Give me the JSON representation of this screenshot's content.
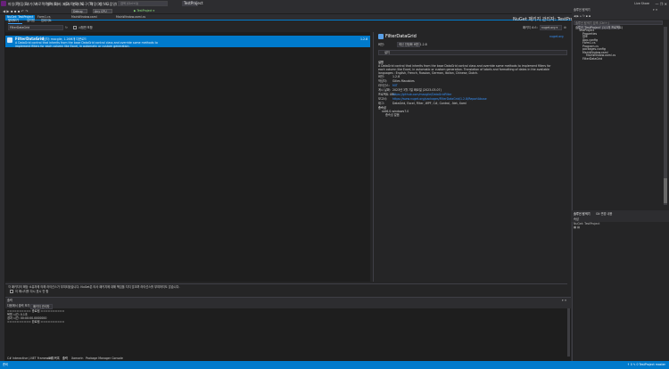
{
  "menu": [
    "파일(F)",
    "편집(E)",
    "보기(V)",
    "프로젝트(P)",
    "빌드(B)",
    "디버그(D)",
    "테스트(S)",
    "분석(N)",
    "도구(T)",
    "확장(X)",
    "창(W)",
    "도움말(H)"
  ],
  "search_placeholder": "검색 (Ctrl+Q)",
  "project_name": "TestProject",
  "window": {
    "user": "Live Share",
    "controls": "—  ❐  ✕"
  },
  "toolbar": {
    "config": "Debug",
    "platform": "Any CPU",
    "run": "▶ TestProject ▾"
  },
  "doc_tabs": [
    "NuGet: TestProject",
    "Form1.cs",
    "MainWindow.xaml",
    "MainWindow.xaml.cs"
  ],
  "nuget": {
    "title": "NuGet 패키지 관리자: TestProject",
    "tabs": [
      "찾아보기",
      "설치됨",
      "업데이트"
    ],
    "search_value": "FilterDataGrid",
    "prerelease": "시험판 포함",
    "source_label": "패키지 소스:",
    "source_value": "nuget.org ▾",
    "package": {
      "name": "FilterDataGrid",
      "author": "작성자: macgile, 1.26M개 다운로드",
      "desc1": "A DataGrid control that inherits from the base DataGrid control class and override some methods to",
      "desc2": "implement filters for each column like Excel, in automatic or custom generation.",
      "version": "1.2.8"
    },
    "detail": {
      "name": "FilterDataGrid",
      "nuget_link": "nuget.org",
      "version_label": "버전:",
      "version_value": "최신 안정화 버전 1.2.8",
      "install": "설치",
      "desc_label": "설명",
      "desc": "A DataGrid control that inherits from the base DataGrid control class and override some methods to implement filters for each column like Excel, in automatic or custom generation. Translation of labels and formatting of dates in the available languages : English, French, Russian, German, Italian, Chinese, Dutch.",
      "rows": [
        {
          "k": "버전:",
          "v": "1.2.8"
        },
        {
          "k": "작성자:",
          "v": "Gilles Macabies"
        },
        {
          "k": "라이선스:",
          "v": "MIT"
        },
        {
          "k": "게시 날짜:",
          "v": "2023년 3월 7일 화요일 (2023-03-07)"
        },
        {
          "k": "프로젝트 URL:",
          "v": "https://github.com/macgile/DataGridFilter"
        },
        {
          "k": "보고서:",
          "v": "https://www.nuget.org/packages/FilterDataGrid/1.2.8/ReportAbuse"
        },
        {
          "k": "태그:",
          "v": "DataGrid, Excel, Filter, WPF, C#, Control, .Net, Xaml"
        }
      ],
      "deps_label": "종속성",
      "deps": [
        "net6.0-windows7.0",
        "종속성 없음"
      ]
    },
    "note": "각 패키지의 해당 소유자에 의해 라이선스가 부여되었습니다. NuGet은 타사 패키지에 대해 책임을 지지 않으며 라이선스를 부여하지도 않습니다.",
    "dont_show": "이 메시지를 다시 표시 안 함"
  },
  "output": {
    "title": "출력",
    "show_from": "다음에서 출력 보기:",
    "source": "패키지 관리자",
    "lines": [
      "========== 종료됨 ==========",
      "복원 시간: 0.1초",
      "경과 시간: 00:00:00.0000000",
      "========== 완료됨 =========="
    ],
    "tabs": [
      "C# Interactive (.NET Framework)",
      "오류 목록",
      "출력",
      "Xamarin",
      "Package Manager Console"
    ]
  },
  "solution": {
    "title": "솔루션 탐색기",
    "search": "솔루션 탐색기 검색 (Ctrl+;)",
    "items": [
      "솔루션 'TestProject' (1/1개 프로젝트)",
      "TestProject",
      "Properties",
      "참조",
      "App.config",
      "Form1.cs",
      "Program.cs",
      "packages.config",
      "MainWindow.xaml",
      "MainWindow.xaml.cs",
      "FilterDataGrid"
    ]
  },
  "properties": {
    "tabs": [
      "솔루션 탐색기",
      "Git 변경 내용"
    ],
    "title": "속성",
    "subtitle": "NuGet: TestProject"
  },
  "status": {
    "left": "준비",
    "right": "↑ 0  ✎ 0  TestProject  master"
  }
}
